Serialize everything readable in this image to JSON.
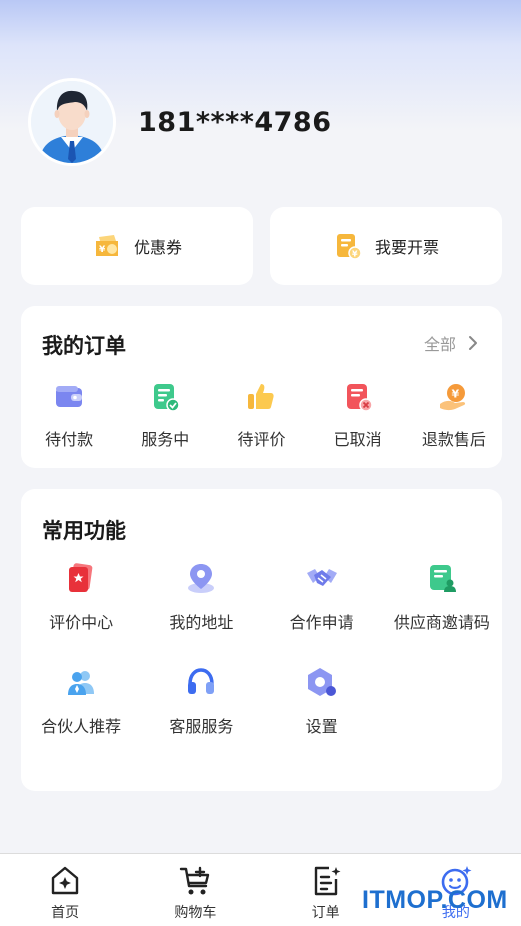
{
  "profile": {
    "phone": "181****4786"
  },
  "quick_actions": [
    {
      "label": "优惠券",
      "icon": "coupon-icon"
    },
    {
      "label": "我要开票",
      "icon": "invoice-icon"
    }
  ],
  "orders": {
    "title": "我的订单",
    "view_all": "全部",
    "items": [
      {
        "label": "待付款",
        "icon": "wallet-icon"
      },
      {
        "label": "服务中",
        "icon": "checklist-icon"
      },
      {
        "label": "待评价",
        "icon": "thumbs-up-icon"
      },
      {
        "label": "已取消",
        "icon": "cancelled-doc-icon"
      },
      {
        "label": "退款售后",
        "icon": "refund-icon"
      }
    ]
  },
  "functions": {
    "title": "常用功能",
    "items": [
      {
        "label": "评价中心",
        "icon": "review-center-icon"
      },
      {
        "label": "我的地址",
        "icon": "location-pin-icon"
      },
      {
        "label": "合作申请",
        "icon": "handshake-icon"
      },
      {
        "label": "供应商邀请码",
        "icon": "supplier-invite-icon"
      },
      {
        "label": "合伙人推荐",
        "icon": "partner-icon"
      },
      {
        "label": "客服服务",
        "icon": "headset-icon"
      },
      {
        "label": "设置",
        "icon": "settings-icon"
      }
    ]
  },
  "tabbar": [
    {
      "label": "首页",
      "icon": "home-icon"
    },
    {
      "label": "购物车",
      "icon": "cart-icon"
    },
    {
      "label": "订单",
      "icon": "orders-icon"
    },
    {
      "label": "我的",
      "icon": "profile-face-icon",
      "active": true
    }
  ],
  "watermark": "ITMOP.COM",
  "colors": {
    "accent": "#3d6cf0",
    "background": "#f3f4f8"
  }
}
